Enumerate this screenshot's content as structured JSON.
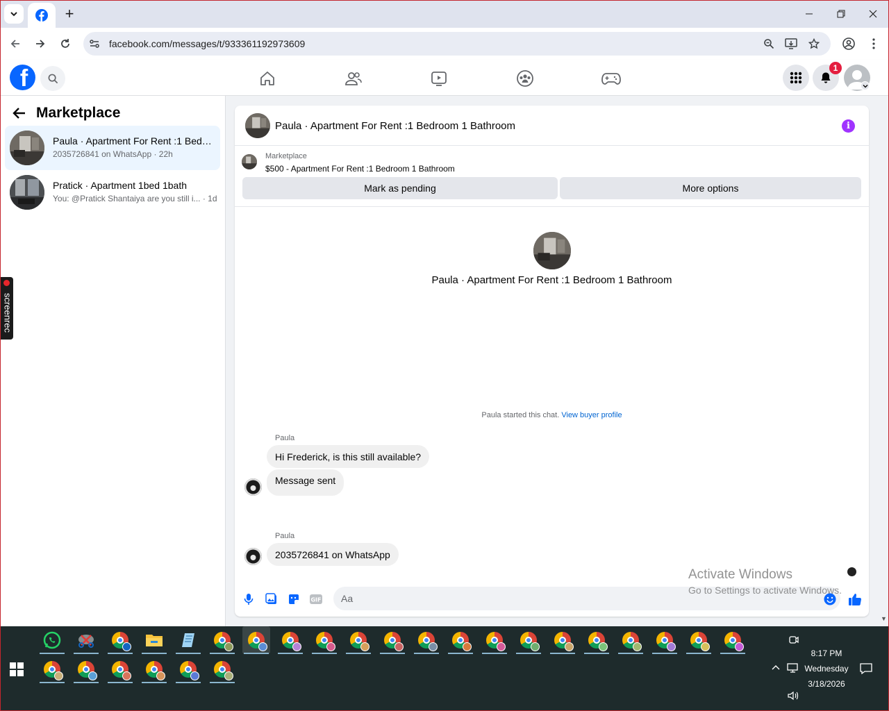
{
  "browser": {
    "url": "facebook.com/messages/t/933361192973609"
  },
  "sidebar": {
    "title": "Marketplace",
    "conversations": [
      {
        "title": "Paula · Apartment For Rent :1 Bedroom 1 Bathroom",
        "subtitle": "2035726841 on WhatsApp · 22h",
        "active": true
      },
      {
        "title": "Pratick · Apartment 1bed 1bath",
        "subtitle": "You: @Pratick Shantaiya are you still i... · 1d",
        "active": false
      }
    ]
  },
  "notifications": {
    "count": "1"
  },
  "screenrec": {
    "label": "screenrec"
  },
  "chat": {
    "header_title": "Paula · Apartment For Rent :1 Bedroom 1 Bathroom",
    "listing": {
      "label": "Marketplace",
      "title": "$500 - Apartment For Rent :1 Bedroom 1 Bathroom",
      "mark_pending": "Mark as pending",
      "more_options": "More options"
    },
    "thread_title": "Paula · Apartment For Rent :1 Bedroom 1 Bathroom",
    "started_text": "Paula started this chat.",
    "buyer_profile_link": "View buyer profile",
    "messages": [
      {
        "sender": "Paula",
        "text": "Hi Frederick, is this still available?"
      },
      {
        "sender": "",
        "text": "Message sent"
      },
      {
        "sender": "Paula",
        "text": "2035726841 on  WhatsApp"
      }
    ],
    "composer_placeholder": "Aa"
  },
  "watermark": {
    "line1": "Activate Windows",
    "line2": "Go to Settings to activate Windows."
  },
  "taskbar": {
    "time": "8:17 PM",
    "day": "Wednesday",
    "date": "3/18/2026"
  },
  "colors": {
    "fb_blue": "#0866ff",
    "link_blue": "#0064d1",
    "info_purple": "#a033ff",
    "badge_red": "#e41e3f",
    "taskbar_bg": "#1e2b2c"
  }
}
